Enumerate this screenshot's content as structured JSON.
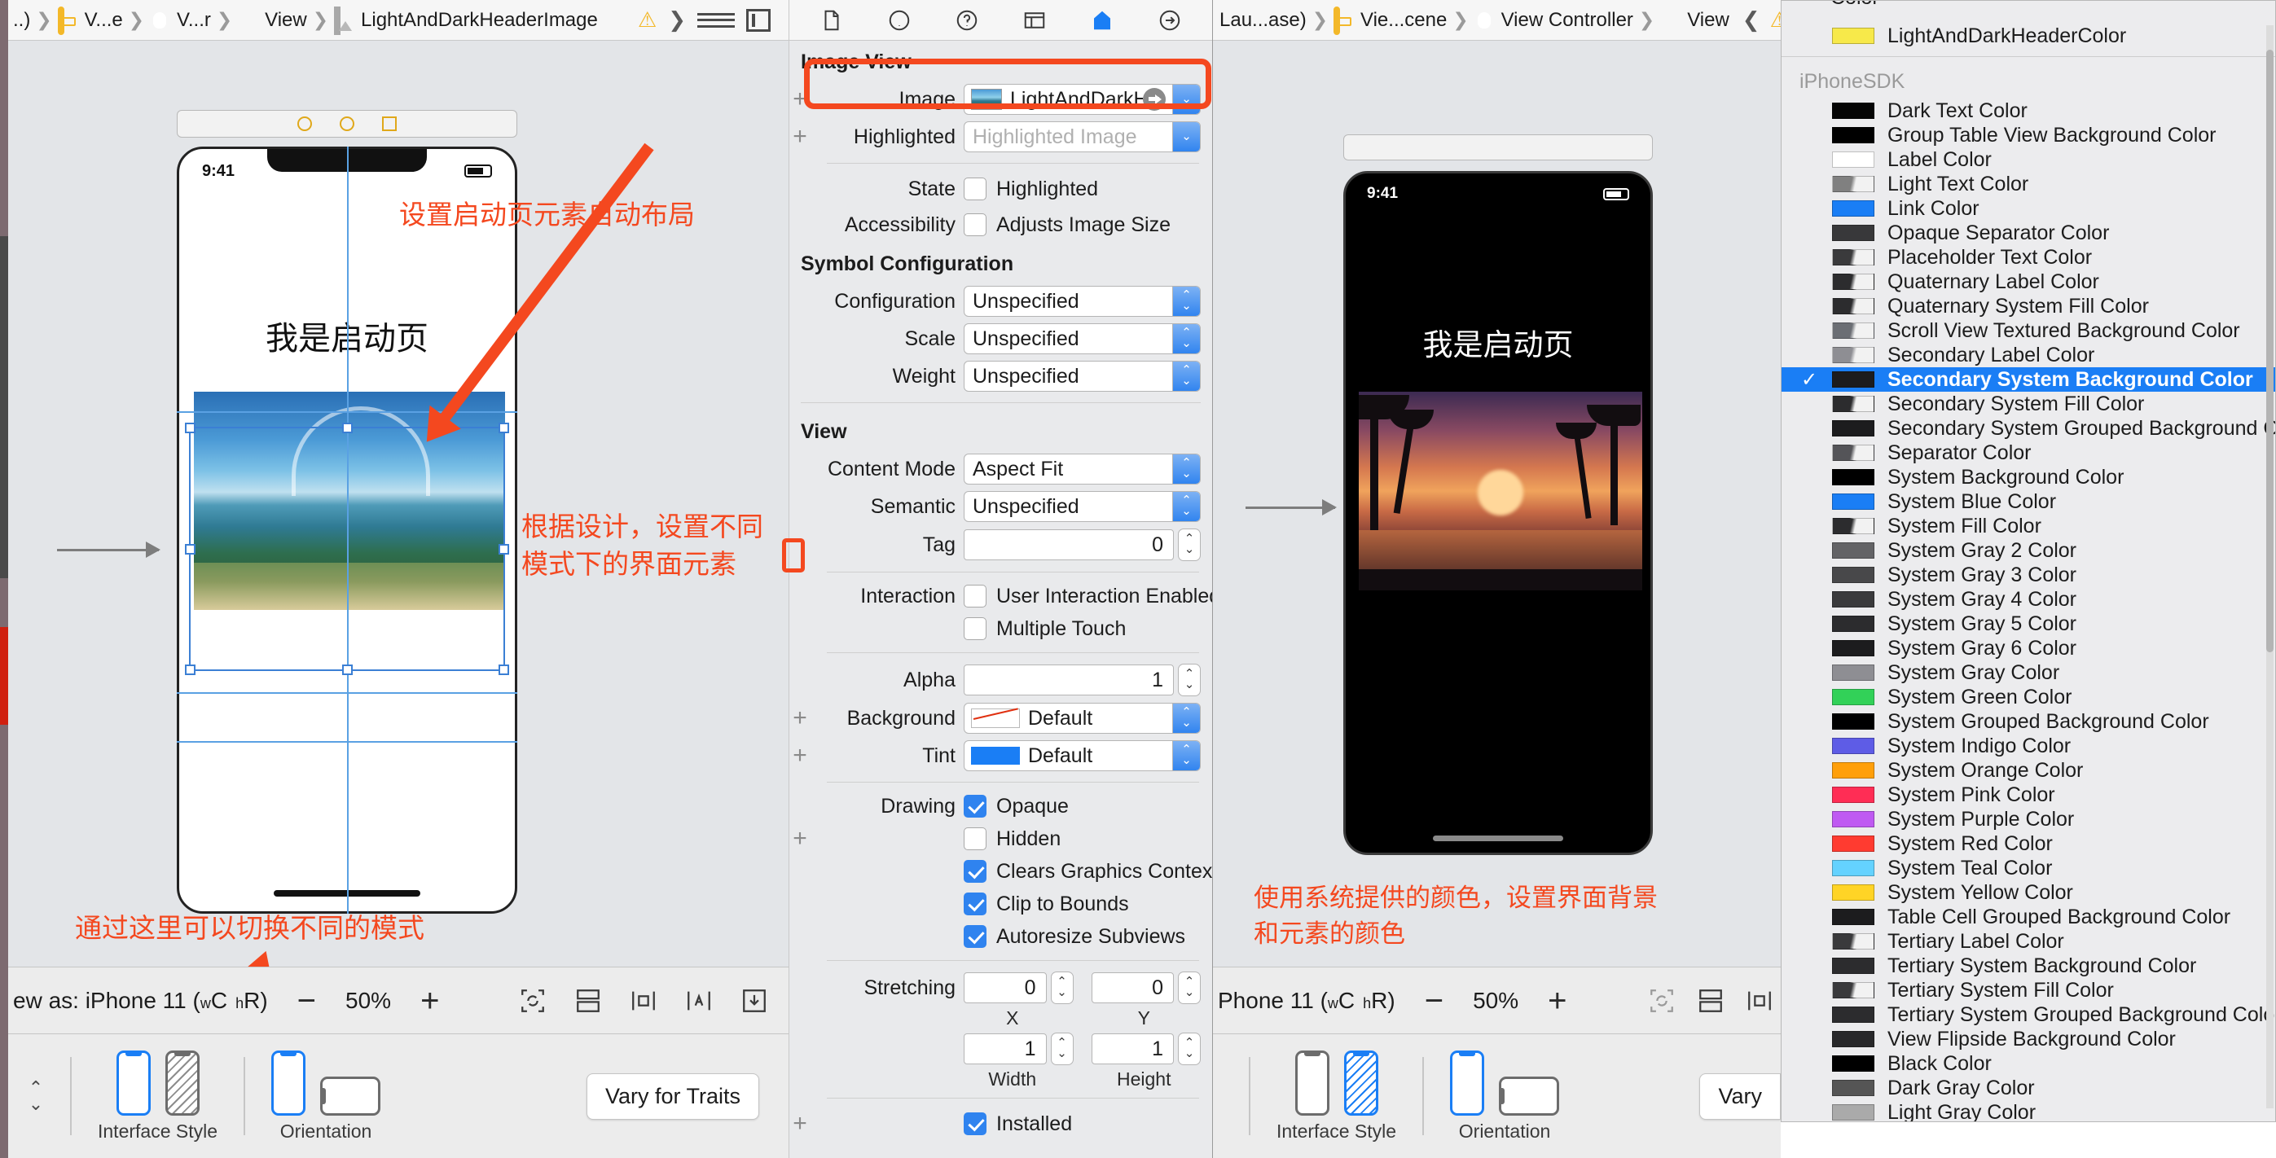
{
  "left_panel": {
    "breadcrumb": [
      {
        "label": "..)",
        "icon": "none"
      },
      {
        "label": "V...e",
        "icon": "storyboard-icon"
      },
      {
        "label": "V...r",
        "icon": "view-controller-icon"
      },
      {
        "label": "View",
        "icon": "view-icon"
      },
      {
        "label": "LightAndDarkHeaderImage",
        "icon": "image-view-icon"
      }
    ],
    "breadcrumb_warning": "⚠",
    "breadcrumb_chevron": "❯",
    "device": {
      "status_time": "9:41",
      "title": "我是启动页"
    },
    "annotations": {
      "top": "设置启动页元素自动布局",
      "middle_line1": "根据设计，设置不同",
      "middle_line2": "模式下的界面元素",
      "bottom": "通过这里可以切换不同的模式"
    },
    "zoom_bar": {
      "view_as_label": "ew as: iPhone 11 (",
      "trait_w": "w",
      "trait_wc": "C",
      "trait_h": "h",
      "trait_hr": "R",
      "close_paren": ")",
      "minus": "−",
      "zoom_level": "50%",
      "plus": "+"
    },
    "traits_bar": {
      "interface_style_label": "Interface Style",
      "orientation_label": "Orientation",
      "vary_button": "Vary for Traits"
    }
  },
  "inspector": {
    "sections": {
      "image_view": {
        "title": "Image View",
        "rows": [
          {
            "label": "Image",
            "value": "LightAndDarkH...",
            "placeholder": "",
            "type": "image-combo"
          },
          {
            "label": "Highlighted",
            "value": "",
            "placeholder": "Highlighted Image",
            "type": "combo"
          }
        ],
        "state_label": "State",
        "state_checkbox": "Highlighted",
        "state_checked": false,
        "accessibility_label": "Accessibility",
        "accessibility_checkbox": "Adjusts Image Size",
        "accessibility_checked": false
      },
      "symbol_configuration": {
        "title": "Symbol Configuration",
        "rows": [
          {
            "label": "Configuration",
            "value": "Unspecified"
          },
          {
            "label": "Scale",
            "value": "Unspecified"
          },
          {
            "label": "Weight",
            "value": "Unspecified"
          }
        ]
      },
      "view": {
        "title": "View",
        "content_mode_label": "Content Mode",
        "content_mode_value": "Aspect Fit",
        "semantic_label": "Semantic",
        "semantic_value": "Unspecified",
        "tag_label": "Tag",
        "tag_value": "0",
        "interaction_label": "Interaction",
        "user_interaction_enabled": "User Interaction Enabled",
        "user_interaction_checked": false,
        "multiple_touch": "Multiple Touch",
        "multiple_touch_checked": false,
        "alpha_label": "Alpha",
        "alpha_value": "1",
        "background_label": "Background",
        "background_value": "Default",
        "tint_label": "Tint",
        "tint_value": "Default",
        "tint_color": "#1a7ef5",
        "drawing_label": "Drawing",
        "opaque": "Opaque",
        "opaque_checked": true,
        "hidden": "Hidden",
        "hidden_checked": false,
        "clears_graphics_context": "Clears Graphics Context",
        "clears_graphics_checked": true,
        "clip_to_bounds": "Clip to Bounds",
        "clip_to_bounds_checked": true,
        "autoresize_subviews": "Autoresize Subviews",
        "autoresize_checked": true,
        "stretching_label": "Stretching",
        "stretch_x": "0",
        "stretch_y": "0",
        "stretch_width": "1",
        "stretch_height": "1",
        "sub_x": "X",
        "sub_y": "Y",
        "sub_width": "Width",
        "sub_height": "Height",
        "installed": "Installed",
        "installed_checked": true
      }
    }
  },
  "right_panel": {
    "breadcrumb": [
      {
        "label": "Lau...ase)",
        "icon": "none"
      },
      {
        "label": "Vie...cene",
        "icon": "storyboard-icon"
      },
      {
        "label": "View Controller",
        "icon": "view-controller-icon"
      },
      {
        "label": "View",
        "icon": "view-icon"
      }
    ],
    "breadcrumb_back": "❮",
    "breadcrumb_warning": "⚠",
    "breadcrumb_forward": "❯",
    "device": {
      "status_time": "9:41",
      "title": "我是启动页"
    },
    "annotation_line1": "使用系统提供的颜色，设置界面背景",
    "annotation_line2": "和元素的颜色",
    "zoom_bar": {
      "view_as_label": "Phone 11 (",
      "trait_w": "w",
      "trait_wc": "C",
      "trait_h": "h",
      "trait_hr": "R",
      "close_paren": ")",
      "minus": "−",
      "zoom_level": "50%",
      "plus": "+"
    },
    "traits_bar": {
      "interface_style_label": "Interface Style",
      "orientation_label": "Orientation",
      "vary_button": "Vary"
    }
  },
  "color_popover": {
    "custom_items": [
      {
        "name": "LightAndDarkHeaderColor",
        "swatch": "#f7e94a",
        "type": "solid",
        "selected": false
      }
    ],
    "group_label": "iPhoneSDK",
    "selected_index": 11,
    "items": [
      {
        "name": "Dark Text Color",
        "swatch": "#050505",
        "type": "solid"
      },
      {
        "name": "Group Table View Background Color",
        "swatch": "#000000",
        "type": "solid"
      },
      {
        "name": "Label Color",
        "swatch": "#ffffff",
        "type": "solid"
      },
      {
        "name": "Light Text Color",
        "swatch": "#808080",
        "type": "gradient"
      },
      {
        "name": "Link Color",
        "swatch": "#1a7ef5",
        "type": "solid"
      },
      {
        "name": "Opaque Separator Color",
        "swatch": "#38383a",
        "type": "solid"
      },
      {
        "name": "Placeholder Text Color",
        "swatch": "#3a3a3c",
        "type": "gradient"
      },
      {
        "name": "Quaternary Label Color",
        "swatch": "#2c2c2e",
        "type": "gradient"
      },
      {
        "name": "Quaternary System Fill Color",
        "swatch": "#2c2c2e",
        "type": "gradient"
      },
      {
        "name": "Scroll View Textured Background Color",
        "swatch": "#6b6e74",
        "type": "gradient"
      },
      {
        "name": "Secondary Label Color",
        "swatch": "#8e8e93",
        "type": "gradient"
      },
      {
        "name": "Secondary System Background Color",
        "swatch": "#1c1c1e",
        "type": "solid"
      },
      {
        "name": "Secondary System Fill Color",
        "swatch": "#2c2c2e",
        "type": "gradient"
      },
      {
        "name": "Secondary System Grouped Background Color",
        "swatch": "#1c1c1e",
        "type": "solid"
      },
      {
        "name": "Separator Color",
        "swatch": "#545458",
        "type": "gradient"
      },
      {
        "name": "System Background Color",
        "swatch": "#000000",
        "type": "solid"
      },
      {
        "name": "System Blue Color",
        "swatch": "#1a7ef5",
        "type": "solid"
      },
      {
        "name": "System Fill Color",
        "swatch": "#2c2c2e",
        "type": "gradient"
      },
      {
        "name": "System Gray 2 Color",
        "swatch": "#636366",
        "type": "solid"
      },
      {
        "name": "System Gray 3 Color",
        "swatch": "#48484a",
        "type": "solid"
      },
      {
        "name": "System Gray 4 Color",
        "swatch": "#3a3a3c",
        "type": "solid"
      },
      {
        "name": "System Gray 5 Color",
        "swatch": "#2c2c2e",
        "type": "solid"
      },
      {
        "name": "System Gray 6 Color",
        "swatch": "#1c1c1e",
        "type": "solid"
      },
      {
        "name": "System Gray Color",
        "swatch": "#8e8e93",
        "type": "solid"
      },
      {
        "name": "System Green Color",
        "swatch": "#32d158",
        "type": "solid"
      },
      {
        "name": "System Grouped Background Color",
        "swatch": "#000000",
        "type": "solid"
      },
      {
        "name": "System Indigo Color",
        "swatch": "#5e5ce6",
        "type": "solid"
      },
      {
        "name": "System Orange Color",
        "swatch": "#ff9f0a",
        "type": "solid"
      },
      {
        "name": "System Pink Color",
        "swatch": "#ff2d55",
        "type": "solid"
      },
      {
        "name": "System Purple Color",
        "swatch": "#bf5af2",
        "type": "solid"
      },
      {
        "name": "System Red Color",
        "swatch": "#ff3b30",
        "type": "solid"
      },
      {
        "name": "System Teal Color",
        "swatch": "#64d2ff",
        "type": "solid"
      },
      {
        "name": "System Yellow Color",
        "swatch": "#ffd426",
        "type": "solid"
      },
      {
        "name": "Table Cell Grouped Background Color",
        "swatch": "#1c1c1e",
        "type": "solid"
      },
      {
        "name": "Tertiary Label Color",
        "swatch": "#3a3a3c",
        "type": "gradient"
      },
      {
        "name": "Tertiary System Background Color",
        "swatch": "#2c2c2e",
        "type": "solid"
      },
      {
        "name": "Tertiary System Fill Color",
        "swatch": "#3a3a3c",
        "type": "gradient"
      },
      {
        "name": "Tertiary System Grouped Background Color",
        "swatch": "#2c2c2e",
        "type": "solid"
      },
      {
        "name": "View Flipside Background Color",
        "swatch": "#28282a",
        "type": "solid"
      },
      {
        "name": "Black Color",
        "swatch": "#000000",
        "type": "solid"
      },
      {
        "name": "Dark Gray Color",
        "swatch": "#555555",
        "type": "solid"
      },
      {
        "name": "Light Gray Color",
        "swatch": "#aaaaaa",
        "type": "solid"
      }
    ],
    "top_cut_label": "Color",
    "checkmark": "✓"
  }
}
